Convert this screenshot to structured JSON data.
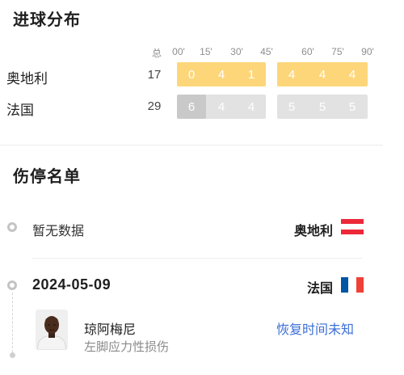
{
  "goal_distribution": {
    "title": "进球分布",
    "headers": {
      "total": "总",
      "t00": "00'",
      "t15": "15'",
      "t30": "30'",
      "t45": "45'",
      "t60": "60'",
      "t75": "75'",
      "t90": "90'"
    },
    "teams": [
      {
        "name": "奥地利",
        "total": "17",
        "intervals": [
          "0",
          "4",
          "1",
          "4",
          "4",
          "4"
        ],
        "color": "#fdd67a",
        "highlight_color": "#f9c24e"
      },
      {
        "name": "法国",
        "total": "29",
        "intervals": [
          "6",
          "4",
          "4",
          "5",
          "5",
          "5"
        ],
        "color": "#e2e2e2",
        "highlight_color": "#c9c9c9"
      }
    ]
  },
  "injury_list": {
    "title": "伤停名单",
    "entries": [
      {
        "text": "暂无数据",
        "team": "奥地利",
        "flag": "austria-flag-icon"
      },
      {
        "date": "2024-05-09",
        "team": "法国",
        "flag": "france-flag-icon"
      }
    ],
    "player": {
      "name": "琼阿梅尼",
      "injury": "左脚应力性损伤",
      "status": "恢复时间未知",
      "status_color": "#3c6fd6"
    }
  }
}
